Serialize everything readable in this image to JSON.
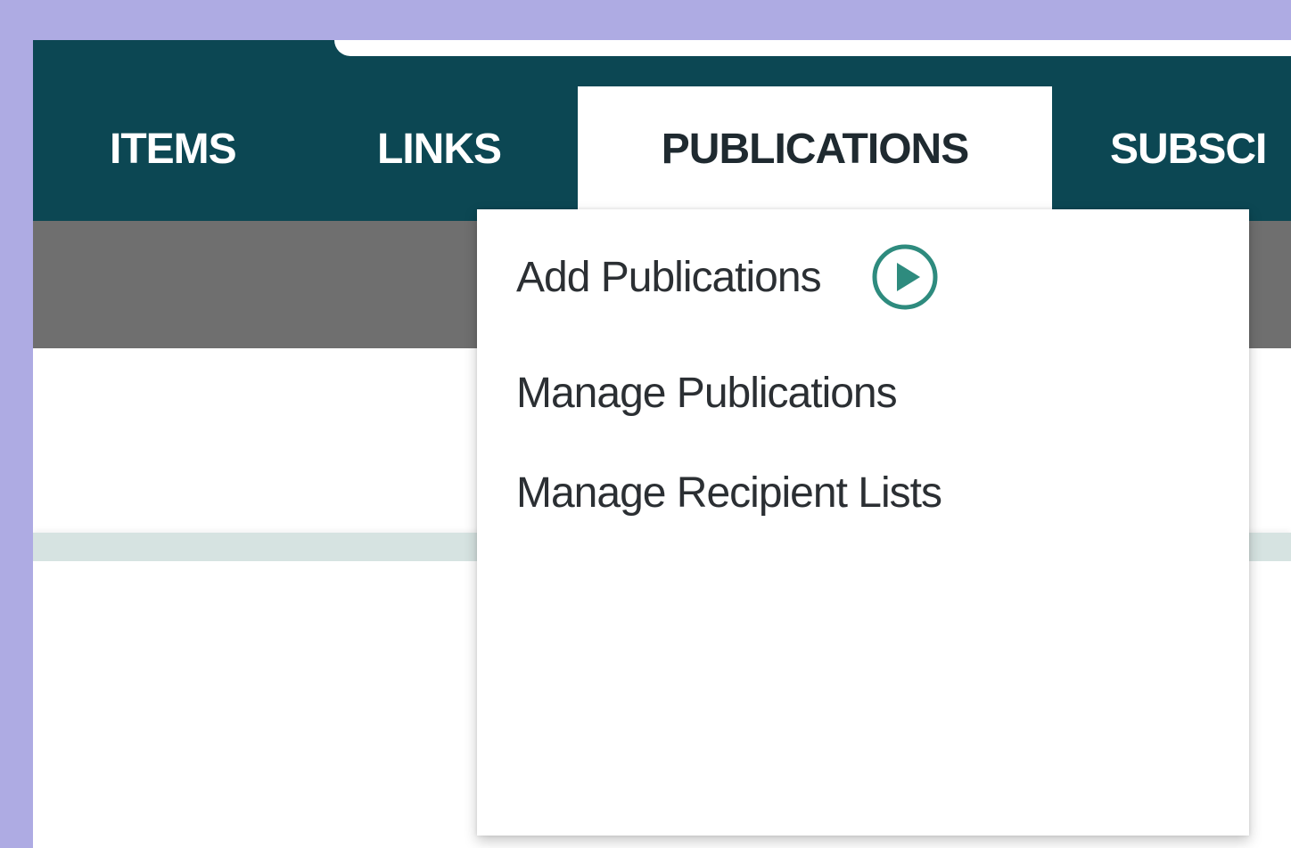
{
  "nav": {
    "tabs": [
      {
        "label": "ITEMS"
      },
      {
        "label": "LINKS"
      },
      {
        "label": "PUBLICATIONS",
        "active": true
      },
      {
        "label": "SUBSCI"
      }
    ]
  },
  "dropdown": {
    "items": [
      {
        "label": "Add Publications",
        "icon": "play-circle-icon"
      },
      {
        "label": "Manage Publications"
      },
      {
        "label": "Manage Recipient Lists"
      }
    ]
  },
  "colors": {
    "background": "#aeabe3",
    "navbar": "#0c4753",
    "subbar": "#6f6f6f",
    "separator": "#d6e3e1",
    "icon_accent": "#2e8b7e"
  }
}
